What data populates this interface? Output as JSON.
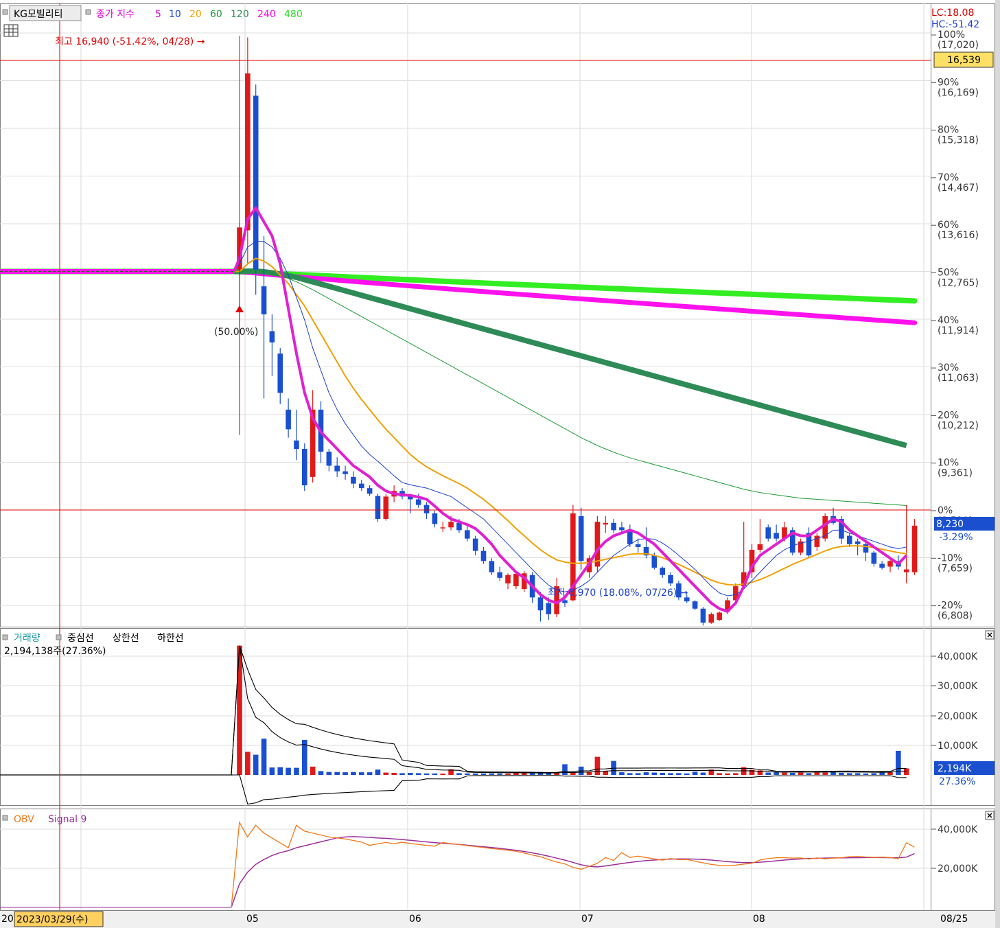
{
  "header": {
    "stock_name": "KG모빌리티",
    "overlay_title": "종가 지수",
    "ma_periods": [
      "5",
      "10",
      "20",
      "60",
      "120",
      "240",
      "480"
    ],
    "lc": "LC:18.08",
    "hc": "HC:-51.42"
  },
  "annotations": {
    "high": "최고 16,940 (-51.42%, 04/28) →",
    "low": "최저 6,970 (18.08%, 07/26) →",
    "pct_marker": "(50.00%)"
  },
  "price_axis": {
    "ticks": [
      {
        "pct": "100%",
        "price": "(17,020)"
      },
      {
        "pct": "90%",
        "price": "(16,169)"
      },
      {
        "pct": "80%",
        "price": "(15,318)"
      },
      {
        "pct": "70%",
        "price": "(14,467)"
      },
      {
        "pct": "60%",
        "price": "(13,616)"
      },
      {
        "pct": "50%",
        "price": "(12,765)"
      },
      {
        "pct": "40%",
        "price": "(11,914)"
      },
      {
        "pct": "30%",
        "price": "(11,063)"
      },
      {
        "pct": "20%",
        "price": "(10,212)"
      },
      {
        "pct": "10%",
        "price": "(9,361)"
      },
      {
        "pct": "0%",
        "price": "(8,510)"
      },
      {
        "pct": "-10%",
        "price": "(7,659)"
      },
      {
        "pct": "-20%",
        "price": "(6,808)"
      }
    ],
    "crosshair_price": "16,539",
    "current_price": "8,230",
    "current_pct": "-3.29%"
  },
  "volume_panel": {
    "title": "거래량",
    "legend": [
      "중심선",
      "상한선",
      "하한선"
    ],
    "current_text": "2,194,138주(27.36%)",
    "ticks": [
      "40,000K",
      "30,000K",
      "20,000K",
      "10,000K"
    ],
    "current_value": "2,194K",
    "current_pct": "27.36%"
  },
  "obv_panel": {
    "title": "OBV",
    "signal": "Signal 9",
    "ticks": [
      "40,000K",
      "20,000K"
    ]
  },
  "date_axis": {
    "prefix": "20",
    "cursor_date": "2023/03/29(수)",
    "months": [
      "05",
      "06",
      "07",
      "08"
    ],
    "last_date": "08/25"
  },
  "chart_data": {
    "type": "candlestick",
    "base_price": 8510,
    "high": {
      "price": 16940,
      "date": "04/28"
    },
    "low": {
      "price": 6970,
      "date": "07/26"
    },
    "candles": [
      {
        "o": 12800,
        "h": 13650,
        "l": 9850,
        "c": 13550
      },
      {
        "o": 13500,
        "h": 16940,
        "l": 12900,
        "c": 16300
      },
      {
        "o": 15900,
        "h": 16100,
        "l": 12350,
        "c": 12800
      },
      {
        "o": 12500,
        "h": 13400,
        "l": 10500,
        "c": 12000
      },
      {
        "o": 11700,
        "h": 12000,
        "l": 10900,
        "c": 11500
      },
      {
        "o": 11300,
        "h": 11400,
        "l": 10400,
        "c": 10600
      },
      {
        "o": 10300,
        "h": 10500,
        "l": 9800,
        "c": 9950
      },
      {
        "o": 9750,
        "h": 10300,
        "l": 9400,
        "c": 9600
      },
      {
        "o": 9600,
        "h": 9700,
        "l": 8850,
        "c": 8950
      },
      {
        "o": 9100,
        "h": 10650,
        "l": 9000,
        "c": 10300
      },
      {
        "o": 10300,
        "h": 10450,
        "l": 9350,
        "c": 9550
      },
      {
        "o": 9550,
        "h": 9600,
        "l": 9200,
        "c": 9300
      },
      {
        "o": 9300,
        "h": 9450,
        "l": 9100,
        "c": 9200
      },
      {
        "o": 9200,
        "h": 9300,
        "l": 9050,
        "c": 9150
      },
      {
        "o": 9100,
        "h": 9200,
        "l": 8900,
        "c": 8980
      },
      {
        "o": 8980,
        "h": 9050,
        "l": 8850,
        "c": 8900
      },
      {
        "o": 8900,
        "h": 8950,
        "l": 8760,
        "c": 8800
      },
      {
        "o": 8760,
        "h": 8800,
        "l": 8300,
        "c": 8350
      },
      {
        "o": 8350,
        "h": 8800,
        "l": 8320,
        "c": 8750
      },
      {
        "o": 8750,
        "h": 8950,
        "l": 8650,
        "c": 8850
      },
      {
        "o": 8850,
        "h": 8900,
        "l": 8700,
        "c": 8750
      },
      {
        "o": 8750,
        "h": 8800,
        "l": 8450,
        "c": 8700
      },
      {
        "o": 8700,
        "h": 8800,
        "l": 8550,
        "c": 8600
      },
      {
        "o": 8600,
        "h": 8650,
        "l": 8350,
        "c": 8450
      },
      {
        "o": 8450,
        "h": 8500,
        "l": 8200,
        "c": 8260
      },
      {
        "o": 8200,
        "h": 8300,
        "l": 8120,
        "c": 8200
      },
      {
        "o": 8200,
        "h": 8400,
        "l": 8150,
        "c": 8300
      },
      {
        "o": 8280,
        "h": 8350,
        "l": 8100,
        "c": 8150
      },
      {
        "o": 8150,
        "h": 8250,
        "l": 7950,
        "c": 8000
      },
      {
        "o": 8000,
        "h": 8050,
        "l": 7700,
        "c": 7780
      },
      {
        "o": 7780,
        "h": 7850,
        "l": 7550,
        "c": 7600
      },
      {
        "o": 7600,
        "h": 7650,
        "l": 7350,
        "c": 7400
      },
      {
        "o": 7400,
        "h": 7500,
        "l": 7250,
        "c": 7300
      },
      {
        "o": 7200,
        "h": 7380,
        "l": 7100,
        "c": 7350
      },
      {
        "o": 7150,
        "h": 7380,
        "l": 7100,
        "c": 7370
      },
      {
        "o": 7100,
        "h": 7420,
        "l": 7050,
        "c": 7380
      },
      {
        "o": 7350,
        "h": 7400,
        "l": 6850,
        "c": 6950
      },
      {
        "o": 6950,
        "h": 7050,
        "l": 6520,
        "c": 6720
      },
      {
        "o": 6850,
        "h": 6950,
        "l": 6550,
        "c": 6650
      },
      {
        "o": 6650,
        "h": 7300,
        "l": 6600,
        "c": 7150
      },
      {
        "o": 6900,
        "h": 7000,
        "l": 6780,
        "c": 6850
      },
      {
        "o": 6900,
        "h": 8600,
        "l": 6880,
        "c": 8450
      },
      {
        "o": 8400,
        "h": 8550,
        "l": 7450,
        "c": 7600
      },
      {
        "o": 7400,
        "h": 7700,
        "l": 7300,
        "c": 7650
      },
      {
        "o": 7500,
        "h": 8400,
        "l": 7400,
        "c": 8300
      },
      {
        "o": 8250,
        "h": 8400,
        "l": 8100,
        "c": 8280
      },
      {
        "o": 8280,
        "h": 8350,
        "l": 8100,
        "c": 8150
      },
      {
        "o": 8200,
        "h": 8300,
        "l": 8100,
        "c": 8150
      },
      {
        "o": 8150,
        "h": 8250,
        "l": 7850,
        "c": 7900
      },
      {
        "o": 7900,
        "h": 8000,
        "l": 7750,
        "c": 7850
      },
      {
        "o": 7850,
        "h": 8200,
        "l": 7650,
        "c": 7700
      },
      {
        "o": 7700,
        "h": 7750,
        "l": 7450,
        "c": 7480
      },
      {
        "o": 7480,
        "h": 7500,
        "l": 7300,
        "c": 7350
      },
      {
        "o": 7350,
        "h": 7400,
        "l": 7150,
        "c": 7200
      },
      {
        "o": 7200,
        "h": 7250,
        "l": 6900,
        "c": 6950
      },
      {
        "o": 6950,
        "h": 7000,
        "l": 6850,
        "c": 6880
      },
      {
        "o": 6880,
        "h": 6900,
        "l": 6720,
        "c": 6750
      },
      {
        "o": 6750,
        "h": 6780,
        "l": 6450,
        "c": 6500
      },
      {
        "o": 6500,
        "h": 6680,
        "l": 6480,
        "c": 6650
      },
      {
        "o": 6550,
        "h": 6700,
        "l": 6530,
        "c": 6680
      },
      {
        "o": 6700,
        "h": 6950,
        "l": 6650,
        "c": 6900
      },
      {
        "o": 6900,
        "h": 7200,
        "l": 6850,
        "c": 7150
      },
      {
        "o": 7150,
        "h": 8300,
        "l": 7100,
        "c": 7400
      },
      {
        "o": 7400,
        "h": 7900,
        "l": 7300,
        "c": 7800
      },
      {
        "o": 7800,
        "h": 8350,
        "l": 7750,
        "c": 7900
      },
      {
        "o": 8200,
        "h": 8250,
        "l": 7950,
        "c": 8000
      },
      {
        "o": 8100,
        "h": 8250,
        "l": 7950,
        "c": 8000
      },
      {
        "o": 8000,
        "h": 8300,
        "l": 7950,
        "c": 8200
      },
      {
        "o": 8150,
        "h": 8200,
        "l": 7700,
        "c": 7750
      },
      {
        "o": 7750,
        "h": 8000,
        "l": 7700,
        "c": 7950
      },
      {
        "o": 8100,
        "h": 8200,
        "l": 7650,
        "c": 7700
      },
      {
        "o": 7850,
        "h": 8100,
        "l": 7780,
        "c": 8050
      },
      {
        "o": 8000,
        "h": 8450,
        "l": 7950,
        "c": 8400
      },
      {
        "o": 8400,
        "h": 8550,
        "l": 8250,
        "c": 8280
      },
      {
        "o": 8350,
        "h": 8400,
        "l": 7900,
        "c": 8000
      },
      {
        "o": 8050,
        "h": 8100,
        "l": 7850,
        "c": 7900
      },
      {
        "o": 7950,
        "h": 8000,
        "l": 7700,
        "c": 7900
      },
      {
        "o": 7900,
        "h": 7950,
        "l": 7600,
        "c": 7750
      },
      {
        "o": 7750,
        "h": 7780,
        "l": 7500,
        "c": 7550
      },
      {
        "o": 7550,
        "h": 7600,
        "l": 7450,
        "c": 7480
      },
      {
        "o": 7500,
        "h": 7650,
        "l": 7400,
        "c": 7600
      },
      {
        "o": 7600,
        "h": 7700,
        "l": 7450,
        "c": 7500
      },
      {
        "o": 7400,
        "h": 8600,
        "l": 7200,
        "c": 7450
      },
      {
        "o": 7400,
        "h": 8350,
        "l": 7350,
        "c": 8230
      }
    ],
    "ma5": [
      13000,
      13700,
      13900,
      13650,
      13400,
      12900,
      12100,
      11300,
      10600,
      10150,
      9900,
      9750,
      9600,
      9450,
      9300,
      9200,
      9100,
      8950,
      8850,
      8800,
      8780,
      8770,
      8740,
      8700,
      8580,
      8450,
      8350,
      8300,
      8250,
      8180,
      8050,
      7900,
      7700,
      7550,
      7400,
      7300,
      7150,
      7000,
      6900,
      6850,
      6950,
      7150,
      7350,
      7550,
      7800,
      7950,
      8050,
      8100,
      8150,
      8100,
      8000,
      7900,
      7750,
      7600,
      7450,
      7300,
      7150,
      7000,
      6850,
      6750,
      6700,
      6850,
      7150,
      7500,
      7700,
      7800,
      7900,
      8000,
      8100,
      8050,
      8050,
      8150,
      8250,
      8350,
      8300,
      8150,
      8050,
      7950,
      7850,
      7750,
      7650,
      7550,
      7700
    ],
    "ma10": [
      12900,
      13200,
      13300,
      13300,
      13200,
      13000,
      12700,
      12300,
      11900,
      11400,
      11000,
      10600,
      10300,
      10050,
      9850,
      9650,
      9500,
      9380,
      9250,
      9120,
      9000,
      8960,
      8930,
      8900,
      8850,
      8800,
      8750,
      8650,
      8550,
      8450,
      8350,
      8200,
      8050,
      7900,
      7750,
      7600,
      7450,
      7300,
      7170,
      7080,
      7050,
      7080,
      7150,
      7250,
      7400,
      7550,
      7700,
      7800,
      7900,
      7980,
      8000,
      7990,
      7920,
      7820,
      7700,
      7580,
      7450,
      7300,
      7150,
      7030,
      6980,
      7000,
      7100,
      7250,
      7400,
      7550,
      7700,
      7800,
      7870,
      7920,
      7950,
      8000,
      8050,
      8150,
      8150,
      8100,
      8050,
      8000,
      7950,
      7900,
      7850,
      7820,
      7850
    ],
    "ma20": [
      12765,
      12900,
      13000,
      12950,
      12850,
      12700,
      12550,
      12350,
      12150,
      11900,
      11650,
      11400,
      11150,
      10900,
      10680,
      10480,
      10300,
      10120,
      9950,
      9800,
      9650,
      9500,
      9380,
      9280,
      9200,
      9120,
      9050,
      8980,
      8900,
      8800,
      8700,
      8580,
      8450,
      8320,
      8180,
      8050,
      7920,
      7800,
      7700,
      7620,
      7580,
      7560,
      7560,
      7570,
      7600,
      7630,
      7660,
      7690,
      7720,
      7730,
      7730,
      7700,
      7660,
      7600,
      7540,
      7470,
      7400,
      7330,
      7260,
      7210,
      7180,
      7170,
      7190,
      7220,
      7270,
      7330,
      7400,
      7470,
      7540,
      7600,
      7660,
      7720,
      7780,
      7830,
      7860,
      7870,
      7870,
      7860,
      7840,
      7810,
      7780,
      7750,
      7730
    ],
    "ma60": [
      12765,
      12780,
      12780,
      12760,
      12730,
      12690,
      12640,
      12580,
      12510,
      12440,
      12360,
      12280,
      12200,
      12120,
      12040,
      11960,
      11880,
      11800,
      11720,
      11640,
      11560,
      11480,
      11400,
      11320,
      11240,
      11160,
      11080,
      11000,
      10920,
      10840,
      10760,
      10680,
      10600,
      10520,
      10440,
      10360,
      10280,
      10200,
      10120,
      10040,
      9960,
      9880,
      9800,
      9730,
      9660,
      9600,
      9540,
      9490,
      9440,
      9400,
      9360,
      9320,
      9280,
      9240,
      9200,
      9160,
      9120,
      9080,
      9040,
      9000,
      8960,
      8920,
      8880,
      8850,
      8820,
      8800,
      8780,
      8760,
      8740,
      8720,
      8710,
      8700,
      8690,
      8680,
      8670,
      8660,
      8650,
      8640,
      8630,
      8620,
      8610,
      8600,
      8590
    ],
    "ma120": [
      12765,
      12770,
      12770,
      12760,
      12740,
      12720,
      12690,
      12660,
      12620,
      12580,
      12540,
      12500,
      12460,
      12420,
      12380,
      12340,
      12300,
      12260,
      12220,
      12180,
      12140,
      12100,
      12060,
      12020,
      11980,
      11940,
      11900,
      11860,
      11820,
      11780,
      11740,
      11700,
      11660,
      11620,
      11580,
      11540,
      11500,
      11460,
      11420,
      11380,
      11340,
      11300,
      11260,
      11220,
      11180,
      11140,
      11100,
      11060,
      11020,
      10980,
      10940,
      10900,
      10860,
      10820,
      10780,
      10740,
      10700,
      10660,
      10620,
      10580,
      10540,
      10500,
      10460,
      10420,
      10380,
      10340,
      10300,
      10260,
      10220,
      10180,
      10140,
      10100,
      10060,
      10020,
      9980,
      9940,
      9900,
      9860,
      9820,
      9780,
      9740,
      9700,
      9660
    ],
    "ma240_start": 12765,
    "ma240_end": 11850,
    "ma480_start": 12765,
    "ma480_end": 12240,
    "volume_k": [
      43500,
      7800,
      6800,
      12200,
      2500,
      2600,
      2400,
      2400,
      11800,
      2800,
      1300,
      1000,
      1000,
      900,
      1000,
      900,
      900,
      1800,
      800,
      700,
      600,
      700,
      600,
      500,
      500,
      400,
      1900,
      600,
      500,
      500,
      500,
      500,
      500,
      400,
      700,
      600,
      600,
      1000,
      900,
      800,
      3600,
      800,
      2800,
      1100,
      6100,
      1300,
      4700,
      900,
      600,
      600,
      900,
      800,
      700,
      600,
      600,
      500,
      1100,
      800,
      1800,
      600,
      500,
      600,
      2600,
      1700,
      1500,
      800,
      900,
      800,
      700,
      800,
      600,
      900,
      800,
      1100,
      700,
      600,
      600,
      500,
      600,
      800,
      900,
      8100,
      2194
    ],
    "obv_k": [
      0,
      43500,
      36000,
      42000,
      38000,
      35500,
      33000,
      30500,
      42000,
      39000,
      38000,
      37000,
      36000,
      35500,
      35000,
      34200,
      33400,
      31700,
      32500,
      33200,
      32600,
      33300,
      32700,
      32200,
      31700,
      31300,
      33200,
      32600,
      32100,
      31600,
      31100,
      30600,
      30100,
      29700,
      29200,
      28700,
      27800,
      26800,
      25900,
      24500,
      23200,
      22300,
      20500,
      19500,
      21000,
      22500,
      25500,
      24000,
      28000,
      25500,
      26200,
      25500,
      24800,
      24200,
      25000,
      24400,
      24500,
      23600,
      22800,
      22000,
      21500,
      21400,
      21600,
      22100,
      22600,
      24200,
      25000,
      25400,
      25400,
      25200,
      25300,
      24700,
      25300,
      24800,
      25200,
      25400,
      25900,
      26100,
      25800,
      25600,
      25700,
      25500,
      24800,
      33000,
      30800
    ],
    "obv_signal_k": [
      0,
      12000,
      18000,
      22000,
      24500,
      26500,
      28000,
      29000,
      30500,
      31500,
      32500,
      33500,
      34500,
      35500,
      36000,
      36200,
      36000,
      35800,
      35500,
      35300,
      35000,
      34700,
      34300,
      33900,
      33500,
      33100,
      32800,
      32500,
      32200,
      31800,
      31400,
      31000,
      30600,
      30200,
      29700,
      29200,
      28600,
      27900,
      27100,
      26200,
      25200,
      24200,
      23000,
      21800,
      21000,
      20700,
      21200,
      21800,
      22400,
      23000,
      23500,
      23900,
      24200,
      24500,
      24700,
      24800,
      24800,
      24700,
      24500,
      24200,
      23800,
      23400,
      23100,
      22900,
      22900,
      23100,
      23400,
      23800,
      24200,
      24500,
      24800,
      25000,
      25100,
      25200,
      25300,
      25300,
      25400,
      25400,
      25500,
      25500,
      25500,
      25400,
      25400,
      25700,
      27500
    ]
  }
}
